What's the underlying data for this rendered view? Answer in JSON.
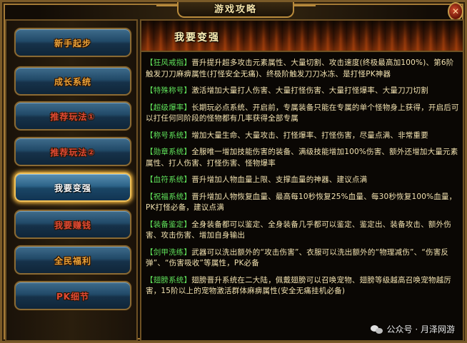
{
  "window": {
    "title": "游戏攻略",
    "close_glyph": "✕"
  },
  "sidebar": {
    "items": [
      {
        "label": "新手起步",
        "style": "gold",
        "active": false
      },
      {
        "label": "成长系统",
        "style": "gold",
        "active": false
      },
      {
        "label": "推荐玩法①",
        "style": "red",
        "active": false
      },
      {
        "label": "推荐玩法②",
        "style": "red",
        "active": false
      },
      {
        "label": "我要变强",
        "style": "white",
        "active": true
      },
      {
        "label": "我要赚钱",
        "style": "red",
        "active": false
      },
      {
        "label": "全民福利",
        "style": "gold",
        "active": false
      },
      {
        "label": "PK细节",
        "style": "red",
        "active": false
      }
    ]
  },
  "main": {
    "header": "我要变强",
    "entries": [
      {
        "tag": "【狂风戒指】",
        "text": "晋升提升超多攻击元素属性、大量切割、攻击速度(终极最高加100%)、第6阶触发刀刀麻痹属性(打怪安全无痛)、终极阶触发刀刀冰冻、是打怪PK神器"
      },
      {
        "tag": "【特殊称号】",
        "text": "激活增加大量打人伤害、大量打怪伤害、大量打怪爆率、大量刀刀切割"
      },
      {
        "tag": "【超级爆率】",
        "text": "长期玩必点系统、开启前，专属装备只能在专属的单个怪物身上获得，开启后可以打任何同阶段的怪物都有几率获得全部专属"
      },
      {
        "tag": "【称号系统】",
        "text": "增加大量生命、大量攻击、打怪爆率、打怪伤害，尽量点满、非常重要"
      },
      {
        "tag": "【勋章系统】",
        "text": "全服唯一增加技能伤害的装备、满级技能增加100%伤害、额外还增加大量元素属性、打人伤害、打怪伤害、怪物爆率"
      },
      {
        "tag": "【血符系统】",
        "text": "晋升增加人物血量上限、支撑血量的神器、建议点满"
      },
      {
        "tag": "【祝福系统】",
        "text": "晋升增加人物恢复血量、最高每10秒恢复25%血量、每30秒恢复100%血量，PK打怪必备，建议点满"
      },
      {
        "tag": "【装备鉴定】",
        "text": "全身装备都可以鉴定、全身装备几乎都可以鉴定、鉴定出、装备攻击、额外伤害、攻击伤害、增加自身输出"
      },
      {
        "tag": "【剑甲洗练】",
        "text": "武器可以洗出额外的“攻击伤害”、衣服可以洗出额外的“物理减伤”、“伤害反弹”、“伤害吸收”等属性，PK必备"
      },
      {
        "tag": "【翅膀系统】",
        "text": "翅膀晋升系统在二大陆，佩戴翅膀可以召唤宠物、翅膀等级越高召唤宠物越厉害，15阶以上的宠物激活群体麻痹属性(安全无痛挂机必备)"
      }
    ]
  },
  "watermark": {
    "text": "公众号 · 月泽网游"
  },
  "colors": {
    "frame_gold": "#b98b3c",
    "button_blue": "#214a68",
    "active_glow": "#f5b840",
    "tag_green": "#5fe05a",
    "body_text": "#f2e2b0",
    "label_gold": "#e9a23a",
    "label_red": "#e04a34"
  }
}
